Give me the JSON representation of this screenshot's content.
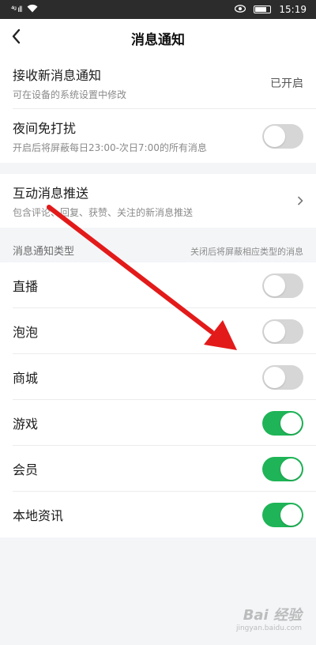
{
  "status_bar": {
    "signal_text": "⁴ᵍ ıll",
    "time": "15:19"
  },
  "header": {
    "title": "消息通知",
    "back_icon": "chevron-left-icon"
  },
  "receive": {
    "label": "接收新消息通知",
    "sub": "可在设备的系统设置中修改",
    "value": "已开启"
  },
  "dnd": {
    "label": "夜间免打扰",
    "sub": "开启后将屏蔽每日23:00-次日7:00的所有消息",
    "enabled": false
  },
  "interactive": {
    "label": "互动消息推送",
    "sub": "包含评论、回复、获赞、关注的新消息推送"
  },
  "types_section": {
    "header": "消息通知类型",
    "hint": "关闭后将屏蔽相应类型的消息",
    "items": [
      {
        "label": "直播",
        "enabled": false
      },
      {
        "label": "泡泡",
        "enabled": false
      },
      {
        "label": "商城",
        "enabled": false
      },
      {
        "label": "游戏",
        "enabled": true
      },
      {
        "label": "会员",
        "enabled": true
      },
      {
        "label": "本地资讯",
        "enabled": true
      }
    ]
  },
  "colors": {
    "toggle_on": "#1fb457",
    "toggle_off": "#d6d6d6",
    "annotation_arrow": "#e31a1a"
  },
  "watermark": {
    "main": "Bai 经验",
    "sub": "jingyan.baidu.com"
  }
}
